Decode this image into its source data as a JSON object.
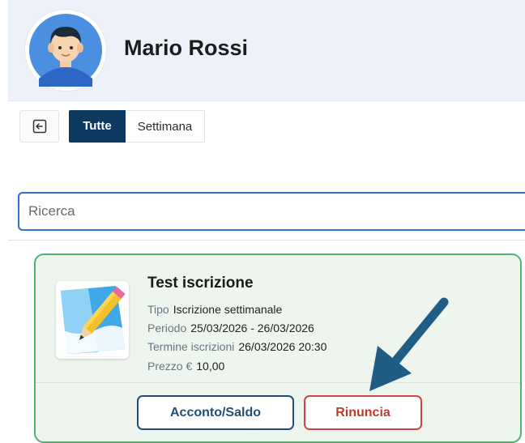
{
  "header": {
    "user_name": "Mario Rossi",
    "avatar_icon": "user-avatar-icon"
  },
  "toolbar": {
    "back_icon": "logout-icon",
    "tabs": [
      {
        "label": "Tutte",
        "active": true
      },
      {
        "label": "Settimana",
        "active": false
      }
    ]
  },
  "search": {
    "placeholder": "Ricerca",
    "value": ""
  },
  "card": {
    "title": "Test iscrizione",
    "thumbnail_icon": "pencil-note-icon",
    "fields": {
      "tipo_label": "Tipo",
      "tipo_value": "Iscrizione settimanale",
      "periodo_label": "Periodo",
      "periodo_value": "25/03/2026 - 26/03/2026",
      "termine_label": "Termine iscrizioni",
      "termine_value": "26/03/2026 20:30",
      "prezzo_label": "Prezzo €",
      "prezzo_value": "10,00"
    },
    "buttons": {
      "deposit_label": "Acconto/Saldo",
      "cancel_label": "Rinuncia"
    },
    "border_color": "#4cb66c"
  },
  "colors": {
    "primary": "#0c3960",
    "accent_blue": "#2f6fd0",
    "danger": "#c0392b",
    "arrow": "#1f5d85"
  }
}
